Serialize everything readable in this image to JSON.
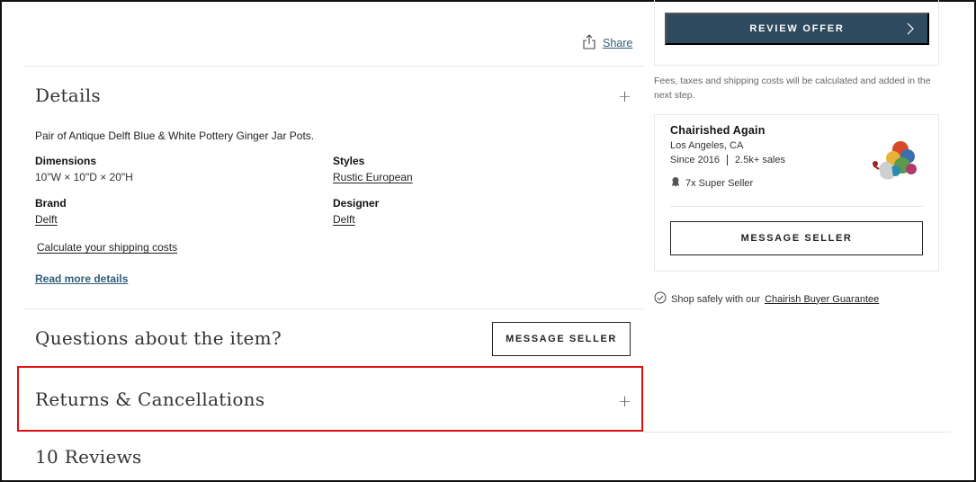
{
  "share": {
    "label": "Share",
    "icon": "share-icon"
  },
  "details": {
    "title": "Details",
    "description": "Pair of Antique Delft Blue & White Pottery Ginger Jar Pots.",
    "dimensions_label": "Dimensions",
    "dimensions_value": "10\"W × 10\"D × 20\"H",
    "styles_label": "Styles",
    "styles_value": "Rustic European",
    "brand_label": "Brand",
    "brand_value": "Delft",
    "designer_label": "Designer",
    "designer_value": "Delft",
    "shipping_link": "Calculate your shipping costs",
    "read_more": "Read more details",
    "expand_symbol": "+"
  },
  "questions": {
    "title": "Questions about the item?",
    "button_label": "MESSAGE SELLER"
  },
  "returns": {
    "title": "Returns & Cancellations",
    "expand_symbol": "+"
  },
  "reviews": {
    "title": "10 Reviews"
  },
  "offer": {
    "button_label": "REVIEW OFFER",
    "fees_note": "Fees, taxes and shipping costs will be calculated and added in the next step."
  },
  "seller": {
    "name": "Chairished Again",
    "location": "Los Angeles, CA",
    "since": "Since 2016",
    "sales": "2.5k+ sales",
    "badge": "7x Super Seller",
    "message_button": "MESSAGE SELLER"
  },
  "guarantee": {
    "prefix": "Shop safely with our",
    "link": "Chairish Buyer Guarantee"
  },
  "colors": {
    "accent": "#2e4a5e",
    "link": "#2f5d78",
    "highlight": "#e01010"
  }
}
